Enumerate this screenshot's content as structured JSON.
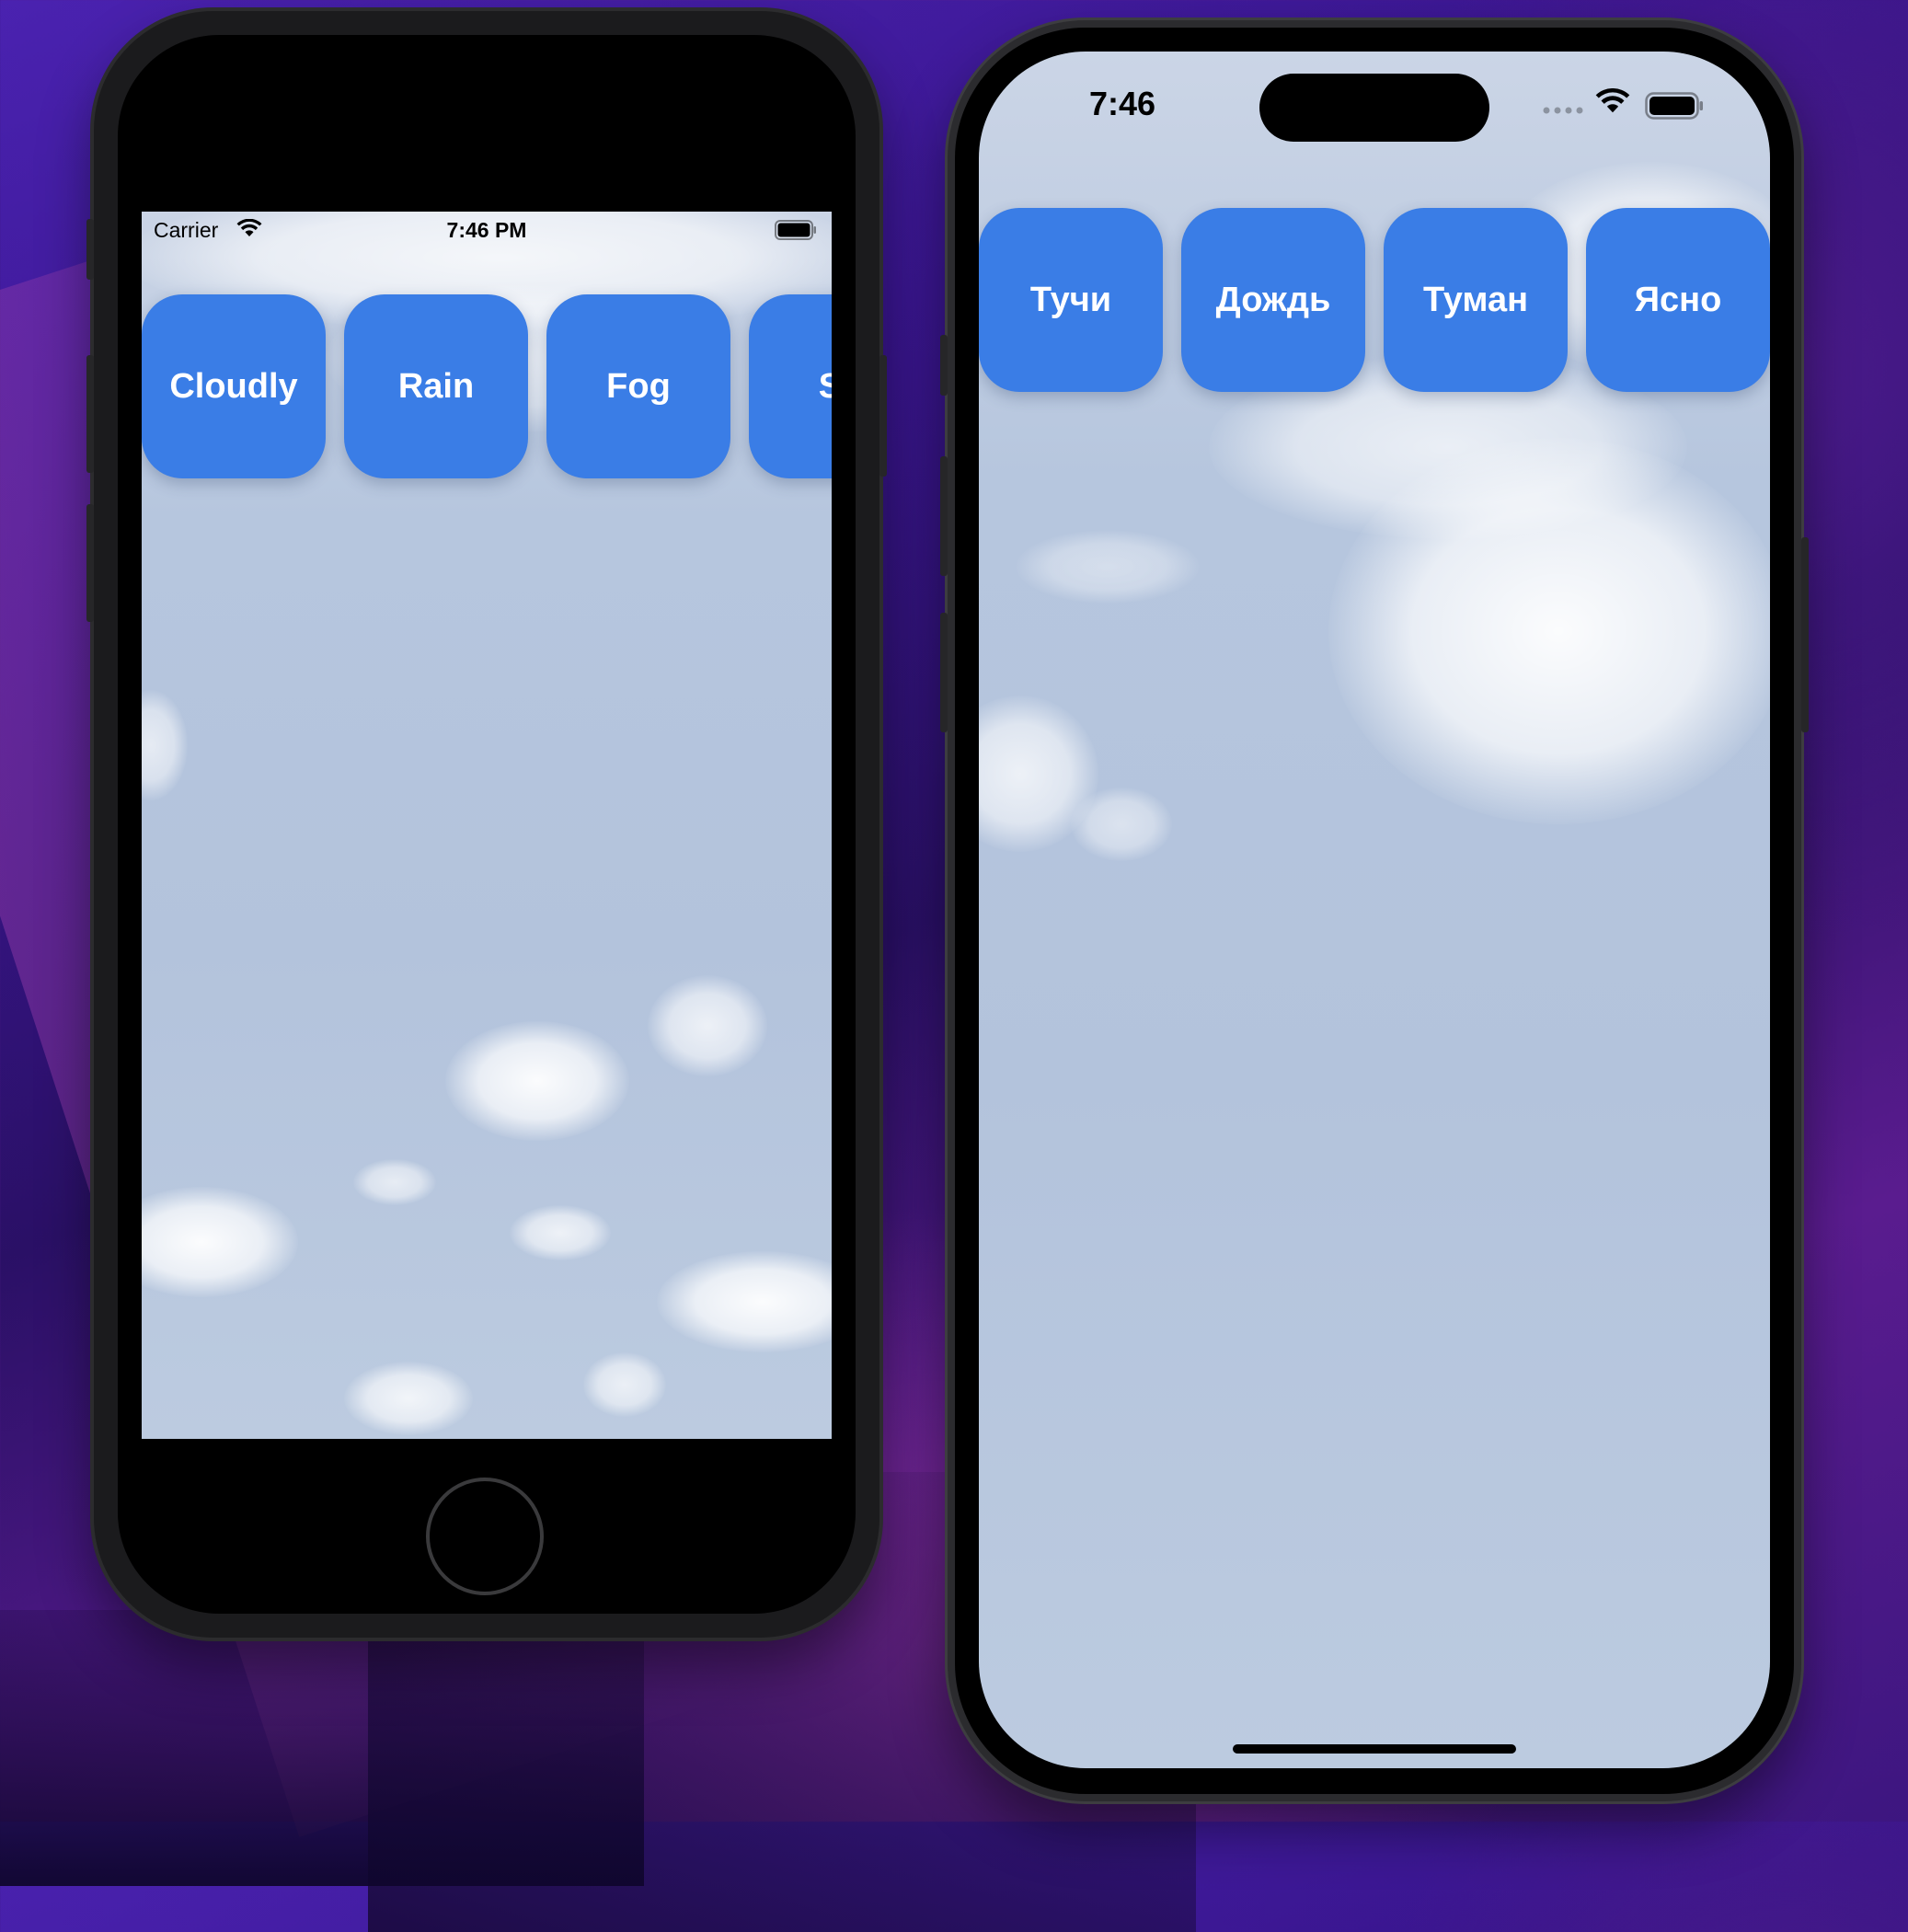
{
  "accent_color": "#3a7de6",
  "device_left": {
    "status_bar": {
      "carrier": "Carrier",
      "time": "7:46 PM",
      "wifi_icon": "wifi-icon",
      "battery_icon": "battery-icon"
    },
    "buttons": [
      {
        "label": "Cloudly"
      },
      {
        "label": "Rain"
      },
      {
        "label": "Fog"
      },
      {
        "label": "Su"
      }
    ],
    "home_button_icon": "home-button"
  },
  "device_right": {
    "status_bar": {
      "time": "7:46",
      "signal_icon": "signal-dots-icon",
      "wifi_icon": "wifi-icon",
      "battery_icon": "battery-icon"
    },
    "buttons": [
      {
        "label": "Тучи"
      },
      {
        "label": "Дождь"
      },
      {
        "label": "Туман"
      },
      {
        "label": "Ясно"
      }
    ]
  }
}
